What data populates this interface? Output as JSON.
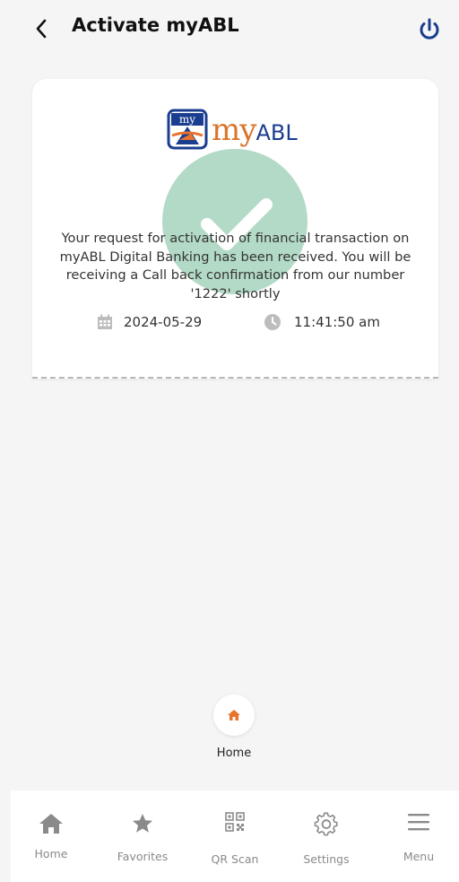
{
  "header": {
    "title": "Activate myABL",
    "back_icon": "chevron-left-icon",
    "power_icon": "power-icon"
  },
  "card": {
    "logo_word": "my",
    "logo_suffix": "ABL",
    "logo_badge": "my",
    "message": "Your request for activation of financial transaction on myABL Digital Banking has been received. You will be receiving a Call back confirmation from our number '1222' shortly",
    "date": "2024-05-29",
    "time": "11:41:50 am",
    "status_icon": "check-circle-icon"
  },
  "home_fab": {
    "label": "Home",
    "icon": "home-icon"
  },
  "bottom_nav": {
    "items": [
      {
        "label": "Home",
        "icon": "home-icon"
      },
      {
        "label": "Favorites",
        "icon": "star-icon"
      },
      {
        "label": "QR Scan",
        "icon": "qr-code-icon"
      },
      {
        "label": "Settings",
        "icon": "gear-icon"
      },
      {
        "label": "Menu",
        "icon": "hamburger-menu-icon"
      }
    ]
  },
  "colors": {
    "accent_orange": "#e8742c",
    "brand_blue": "#1a3d8f",
    "success_green": "#4aa678",
    "nav_gray": "#8a8a8a"
  }
}
